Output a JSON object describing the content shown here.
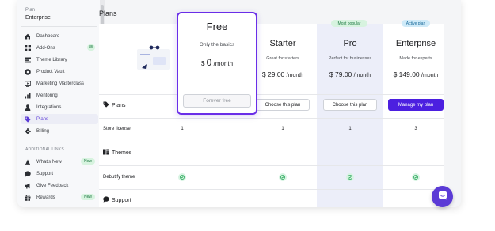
{
  "sidebar": {
    "plan_caption": "Plan",
    "plan_name": "Enterprise",
    "items": [
      {
        "label": "Dashboard",
        "icon": "home-icon"
      },
      {
        "label": "Add-Ons",
        "icon": "grid-icon",
        "badge": "35"
      },
      {
        "label": "Theme Library",
        "icon": "library-icon"
      },
      {
        "label": "Product Vault",
        "icon": "vault-icon"
      },
      {
        "label": "Marketing Masterclass",
        "icon": "video-icon"
      },
      {
        "label": "Mentoring",
        "icon": "chart-icon"
      },
      {
        "label": "Integrations",
        "icon": "person-icon"
      },
      {
        "label": "Plans",
        "icon": "tag-icon",
        "active": true
      },
      {
        "label": "Billing",
        "icon": "gear-icon"
      }
    ],
    "section_label": "ADDITIONAL LINKS",
    "extra_items": [
      {
        "label": "What's New",
        "icon": "bell-icon",
        "badge": "New"
      },
      {
        "label": "Support",
        "icon": "chat-icon"
      },
      {
        "label": "Give Feedback",
        "icon": "megaphone-icon"
      },
      {
        "label": "Rewards",
        "icon": "gift-icon",
        "badge": "New"
      }
    ]
  },
  "main": {
    "title": "Plans",
    "plans": [
      {
        "name": "Free",
        "subtitle": "Only the basics",
        "price": "0",
        "currency": "$",
        "period": "/month",
        "button": "Forever free"
      },
      {
        "name": "Starter",
        "subtitle": "Great for starters",
        "price": "$ 29.00",
        "period": "/month",
        "button": "Choose this plan"
      },
      {
        "name": "Pro",
        "subtitle": "Perfect for businesses",
        "price": "$ 79.00",
        "period": "/month",
        "button": "Choose this plan",
        "pill": "Most popular"
      },
      {
        "name": "Enterprise",
        "subtitle": "Made for experts",
        "price": "$ 149.00",
        "period": "/month",
        "button": "Manage my plan",
        "pill": "Active plan"
      }
    ],
    "rows": {
      "plans_header": "Plans",
      "store_license": {
        "label": "Store license",
        "values": [
          "1",
          "1",
          "1",
          "3"
        ]
      },
      "themes_header": "Themes",
      "debutify_theme": {
        "label": "Debutify theme"
      },
      "support_header": "Support"
    }
  },
  "colors": {
    "accent": "#4c1fe0",
    "highlight_border": "#6a2ee8",
    "badge_green_bg": "#d7f3df",
    "check_green": "#2faa5e"
  }
}
